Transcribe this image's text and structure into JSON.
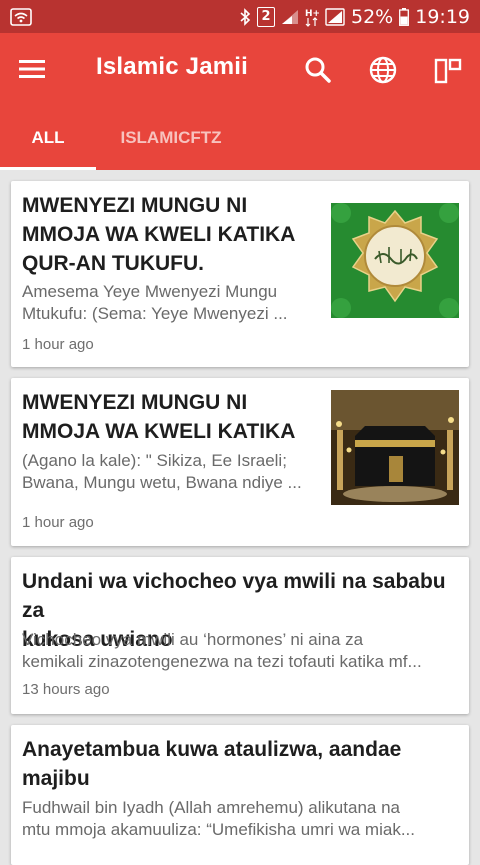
{
  "status_bar": {
    "sim_badge": "2",
    "battery_percent": "52%",
    "time": "19:19",
    "icons": [
      "wifi-icon",
      "bluetooth-icon",
      "sim-badge",
      "signal-icon",
      "data-h-plus-icon",
      "signal-icon",
      "battery-icon"
    ]
  },
  "app_bar": {
    "title": "Islamic Jamii",
    "icons": [
      "menu-icon",
      "search-icon",
      "globe-icon",
      "layout-icon"
    ],
    "color": "#e8453c"
  },
  "tabs": [
    {
      "label": "ALL",
      "selected": true
    },
    {
      "label": "ISLAMICFTZ",
      "selected": false
    }
  ],
  "articles": [
    {
      "title_lines": [
        "MWENYEZI MUNGU NI",
        "MMOJA WA KWELI KATIKA",
        "QUR-AN TUKUFU."
      ],
      "excerpt_lines": [
        "Amesema Yeye Mwenyezi Mungu",
        "Mtukufu: (Sema: Yeye Mwenyezi ..."
      ],
      "time": "1 hour ago",
      "thumbnail": "calligraphy-image"
    },
    {
      "title_lines": [
        "MWENYEZI MUNGU NI",
        "MMOJA WA KWELI KATIKA"
      ],
      "excerpt_lines": [
        "(Agano la kale): \" Sikiza, Ee Israeli;",
        "Bwana, Mungu wetu, Bwana ndiye ..."
      ],
      "time": "1 hour ago",
      "thumbnail": "kaaba-image"
    },
    {
      "title_lines": [
        "Undani wa vichocheo vya mwili na sababu za",
        "kukosa uwiano"
      ],
      "excerpt_lines": [
        "Vichocheo vya mwili au ‘hormones’ ni aina za",
        "kemikali zinazotengenezwa na tezi tofauti katika mf..."
      ],
      "time": "13 hours ago"
    },
    {
      "title_lines": [
        "Anayetambua kuwa ataulizwa, aandae",
        "majibu"
      ],
      "excerpt_lines": [
        "Fudhwail bin Iyadh (Allah amrehemu) alikutana na",
        "mtu mmoja akamuuliza: “Umefikisha umri wa miak..."
      ],
      "time": ""
    }
  ]
}
